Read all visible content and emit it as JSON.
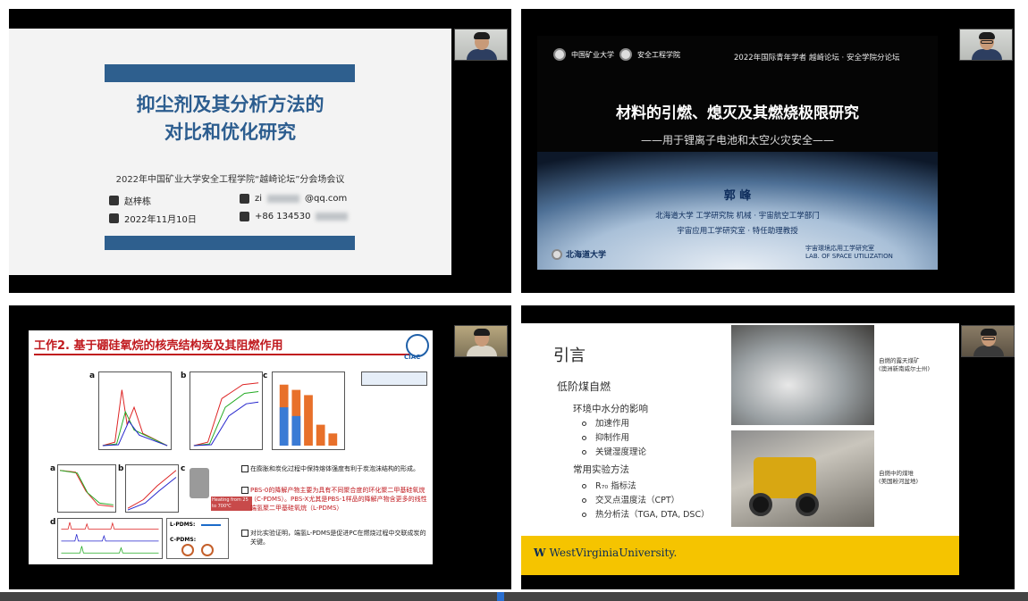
{
  "tile1": {
    "title_line1": "抑尘剂及其分析方法的",
    "title_line2": "对比和优化研究",
    "meeting": "2022年中国矿业大学安全工程学院“越崎论坛”分会场会议",
    "name": "赵梓栋",
    "date": "2022年11月10日",
    "email_suffix": "@qq.com",
    "email_prefix": "zi",
    "phone_prefix": "+86 134530"
  },
  "tile2": {
    "logo1": "中国矿业大学",
    "logo2": "安全工程学院",
    "forum": "2022年国际青年学者 越崎论坛 · 安全学院分论坛",
    "title": "材料的引燃、熄灭及其燃烧极限研究",
    "subtitle": "——用于锂离子电池和太空火灾安全——",
    "speaker": "郭 峰",
    "affiliation1": "北海道大学 工学研究院 机械 · 宇宙航空工学部门",
    "affiliation2": "宇宙应用工学研究室 · 特任助理教授",
    "university": "北海道大学",
    "lab_line1": "宇宙環境応用工学研究室",
    "lab_line2": "LAB. OF SPACE UTILIZATION"
  },
  "tile3": {
    "title": "工作2. 基于硼硅氧烷的核壳结构炭及其阻燃作用",
    "org": "CIAC",
    "panel_labels": [
      "a",
      "b",
      "c",
      "a",
      "b",
      "c",
      "d"
    ],
    "lpdms": "L-PDMS:",
    "cpdms": "C-PDMS:",
    "bullets": [
      "在膨胀和炭化过程中保持熔体强度有利于炭泡沫结构的形成。",
      "PBS-0的降解产物主要为具有不同聚合度的环化聚二甲基硅氧烷（C-PDMS）。PBS-X尤其是PBS-1样品的降解产物含更多的线性端氢聚二甲基硅氧烷（L-PDMS）",
      "对比实验证明，端氢L-PDMS是促进PC在燃烧过程中交联成炭的关键。"
    ],
    "heating_label": "Heating from 25 to 700℃"
  },
  "tile4": {
    "heading": "引言",
    "topic": "低阶煤自燃",
    "section1": "环境中水分的影响",
    "section1_items": [
      "加速作用",
      "抑制作用",
      "关键湿度理论"
    ],
    "section2": "常用实验方法",
    "section2_items": [
      "R₇₀ 指标法",
      "交叉点温度法（CPT）",
      "热分析法（TGA, DTA, DSC）"
    ],
    "caption1_line1": "自燃的露天煤矿",
    "caption1_line2": "(澳洲新南威尔士州)",
    "caption2_line1": "自燃中的煤堆",
    "caption2_line2": "(美国粉河盆地)",
    "university": "WestVirginiaUniversity."
  },
  "colors": {
    "tile3_title_red": "#c0191e",
    "tile1_accent_blue": "#2e5f8e",
    "tile4_footer_gold": "#f5c400"
  }
}
